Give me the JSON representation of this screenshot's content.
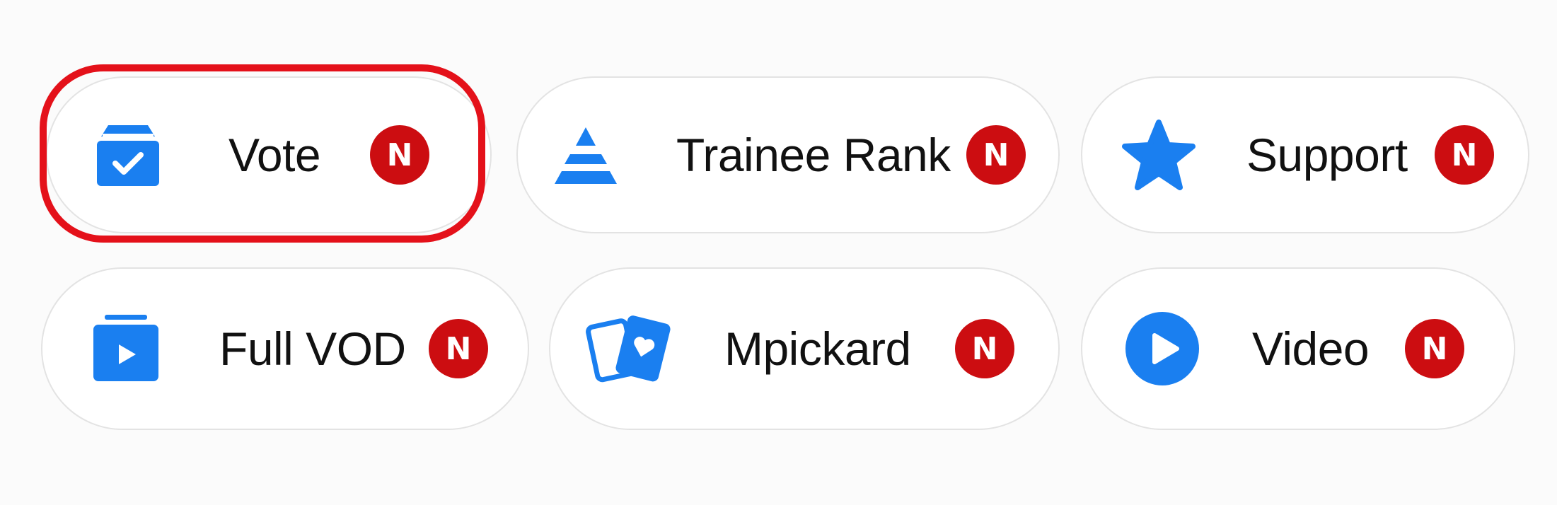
{
  "accent_color": "#1a7ff0",
  "badge_color": "#cc0d11",
  "highlight_color": "#e4111a",
  "menu": {
    "items": [
      {
        "label": "Vote",
        "icon": "ballot-box-icon",
        "badge": "N",
        "highlighted": true
      },
      {
        "label": "Trainee Rank",
        "icon": "pyramid-icon",
        "badge": "N",
        "highlighted": false
      },
      {
        "label": "Support",
        "icon": "star-icon",
        "badge": "N",
        "highlighted": false
      },
      {
        "label": "Full VOD",
        "icon": "video-folder-icon",
        "badge": "N",
        "highlighted": false
      },
      {
        "label": "Mpickard",
        "icon": "photo-cards-icon",
        "badge": "N",
        "highlighted": false
      },
      {
        "label": "Video",
        "icon": "play-circle-icon",
        "badge": "N",
        "highlighted": false
      }
    ]
  }
}
